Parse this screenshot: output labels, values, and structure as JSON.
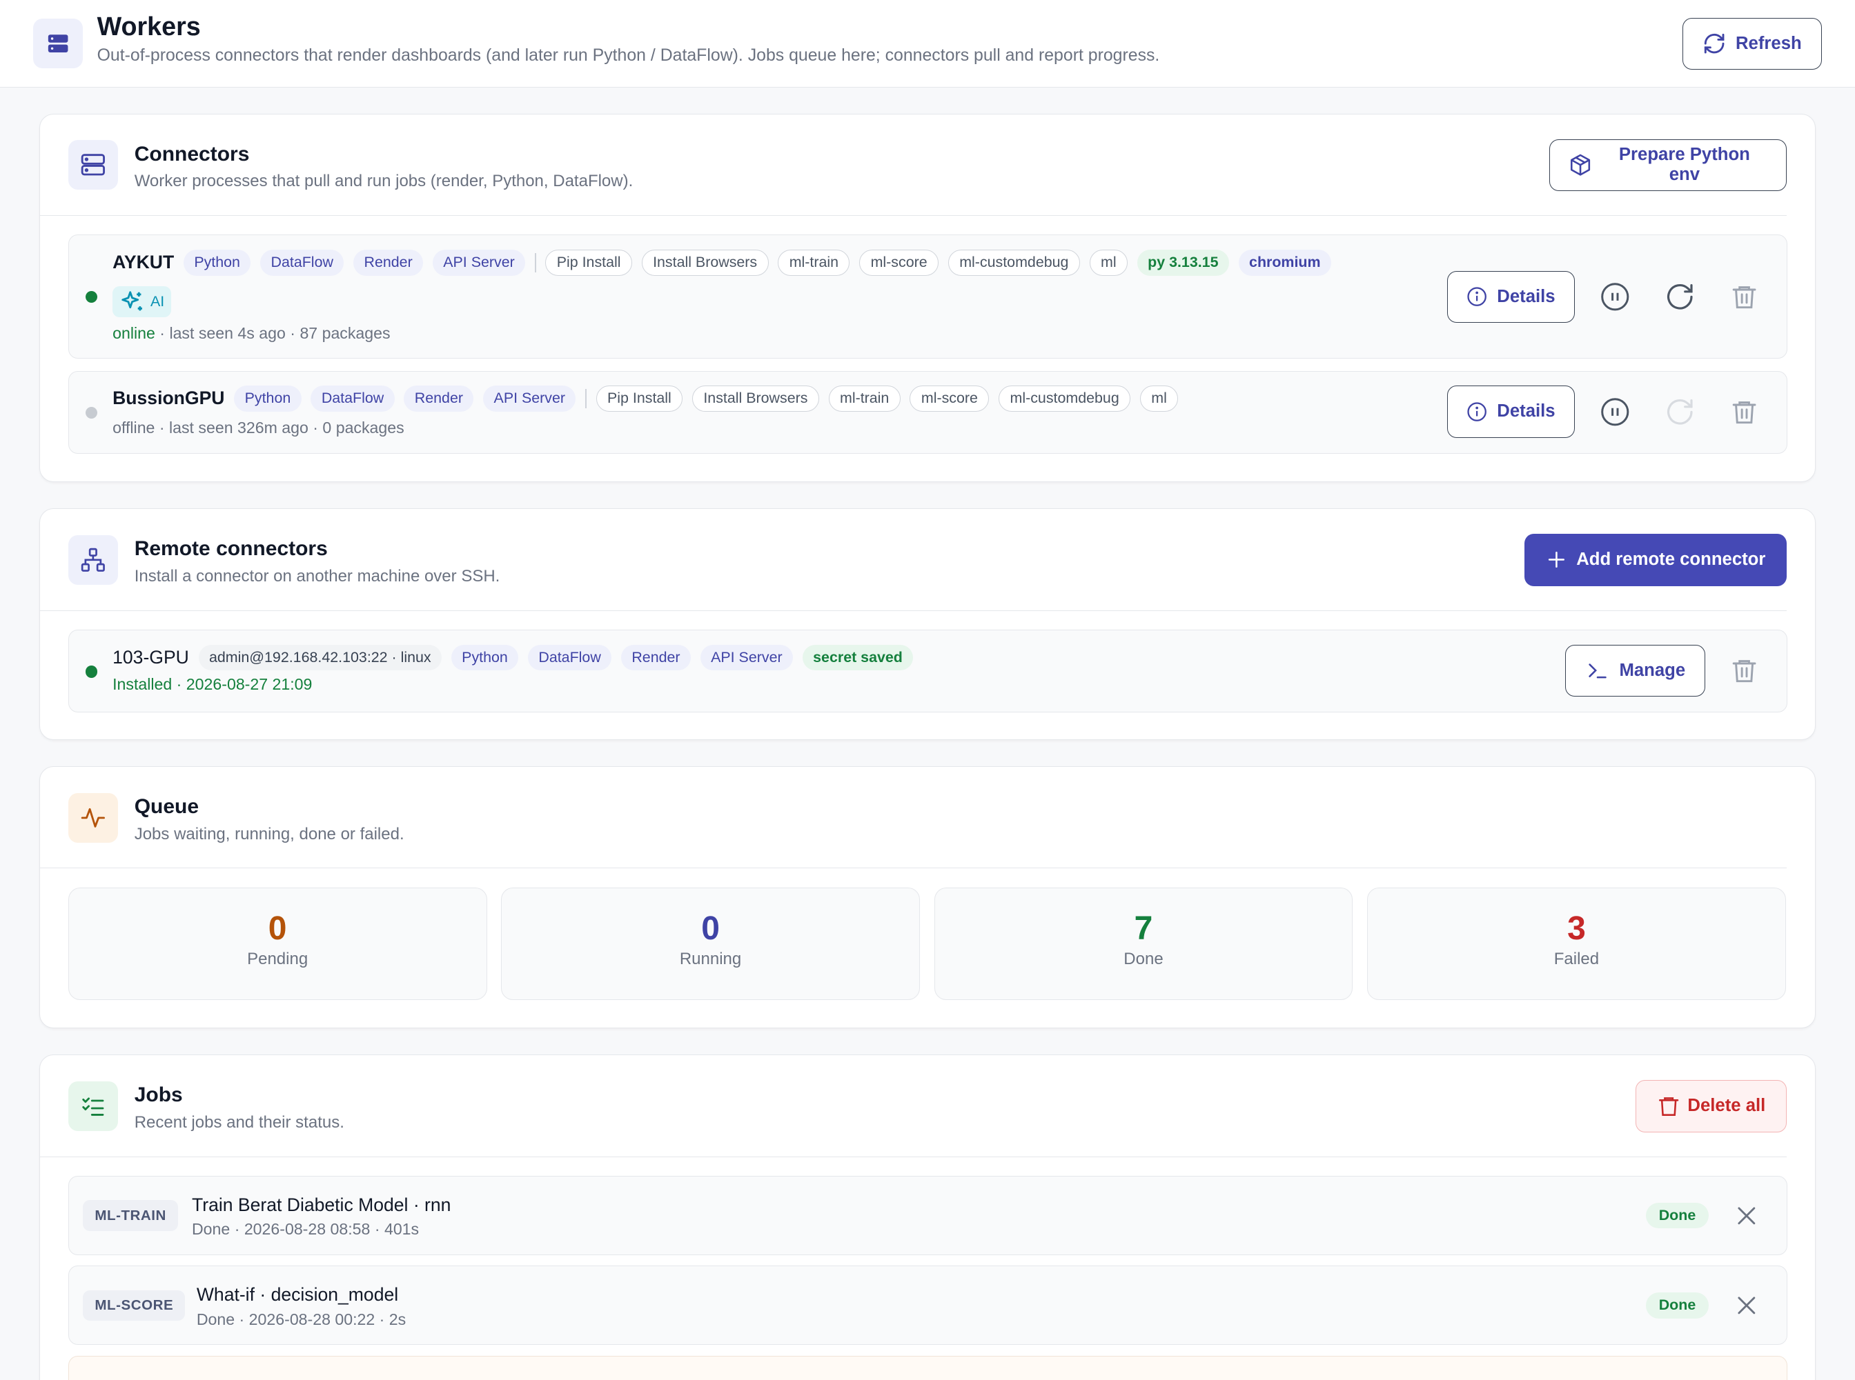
{
  "header": {
    "title": "Workers",
    "subtitle": "Out-of-process connectors that render dashboards (and later run Python / DataFlow). Jobs queue here; connectors pull and report progress.",
    "refresh_label": "Refresh"
  },
  "connectors": {
    "title": "Connectors",
    "subtitle": "Worker processes that pull and run jobs (render, Python, DataFlow).",
    "prepare_label": "Prepare Python env",
    "details_label": "Details",
    "items": [
      {
        "name": "AYKUT",
        "capabilities": [
          "Python",
          "DataFlow",
          "Render",
          "API Server"
        ],
        "tags": [
          "Pip Install",
          "Install Browsers",
          "ml-train",
          "ml-score",
          "ml-customdebug",
          "ml"
        ],
        "runtime": "py 3.13.15",
        "browser": "chromium",
        "ai_label": "AI",
        "status": "online",
        "last_seen": "last seen 4s ago",
        "packages": "87 packages"
      },
      {
        "name": "BussionGPU",
        "capabilities": [
          "Python",
          "DataFlow",
          "Render",
          "API Server"
        ],
        "tags": [
          "Pip Install",
          "Install Browsers",
          "ml-train",
          "ml-score",
          "ml-customdebug",
          "ml"
        ],
        "status": "offline",
        "last_seen": "last seen 326m ago",
        "packages": "0 packages"
      }
    ]
  },
  "remote": {
    "title": "Remote connectors",
    "subtitle": "Install a connector on another machine over SSH.",
    "add_label": "Add remote connector",
    "manage_label": "Manage",
    "items": [
      {
        "name": "103-GPU",
        "host": "admin@192.168.42.103:22 · linux",
        "capabilities": [
          "Python",
          "DataFlow",
          "Render",
          "API Server"
        ],
        "secret": "secret saved",
        "installed": "Installed · 2026-08-27 21:09"
      }
    ]
  },
  "queue": {
    "title": "Queue",
    "subtitle": "Jobs waiting, running, done or failed.",
    "stats": [
      {
        "value": "0",
        "label": "Pending",
        "color": "#b45309"
      },
      {
        "value": "0",
        "label": "Running",
        "color": "#3f43a5"
      },
      {
        "value": "7",
        "label": "Done",
        "color": "#15803d"
      },
      {
        "value": "3",
        "label": "Failed",
        "color": "#c62828"
      }
    ]
  },
  "jobs": {
    "title": "Jobs",
    "subtitle": "Recent jobs and their status.",
    "delete_all_label": "Delete all",
    "items": [
      {
        "kind": "ML-TRAIN",
        "title": "Train Berat Diabetic Model · rnn",
        "meta": "Done · 2026-08-28 08:58 · 401s",
        "status": "Done"
      },
      {
        "kind": "ML-SCORE",
        "title": "What-if · decision_model",
        "meta": "Done · 2026-08-28 00:22 · 2s",
        "status": "Done"
      }
    ]
  },
  "colors": {
    "accent": "#4549b5",
    "online": "#15803d",
    "offline": "#c7cbd1",
    "danger": "#c62828"
  }
}
